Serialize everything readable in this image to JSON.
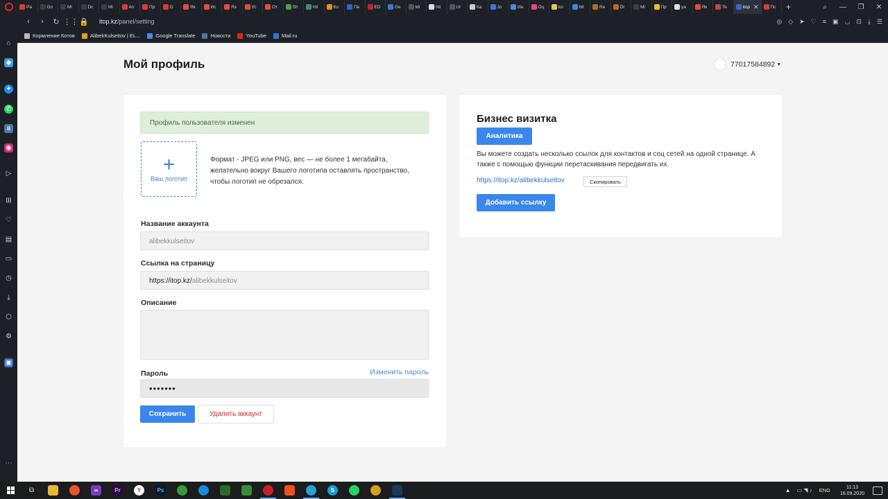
{
  "browser": {
    "tabs": [
      {
        "label": "Pa",
        "color": "#d83a3a"
      },
      {
        "label": "Go",
        "color": "#3a3f46"
      },
      {
        "label": "Mi",
        "color": "#3a3f46"
      },
      {
        "label": "Dc",
        "color": "#3a3f46"
      },
      {
        "label": "Mi",
        "color": "#3a3f46"
      },
      {
        "label": "An",
        "color": "#d83a3a"
      },
      {
        "label": "Пр",
        "color": "#d83a3a"
      },
      {
        "label": "О",
        "color": "#d83a3a"
      },
      {
        "label": "Як",
        "color": "#e84b3c"
      },
      {
        "label": "Ис",
        "color": "#e84b3c"
      },
      {
        "label": "Яз",
        "color": "#e84b3c"
      },
      {
        "label": "Ус",
        "color": "#e84b3c"
      },
      {
        "label": "От",
        "color": "#e84b3c"
      },
      {
        "label": "Sh",
        "color": "#4aa04a"
      },
      {
        "label": "htt",
        "color": "#3d8f6a"
      },
      {
        "label": "Ко",
        "color": "#e28b2a"
      },
      {
        "label": "Пе",
        "color": "#2a6ac8"
      },
      {
        "label": "ED",
        "color": "#c8202a"
      },
      {
        "label": "Ge",
        "color": "#3a7ad0"
      },
      {
        "label": "Mi",
        "color": "#555"
      },
      {
        "label": "htt",
        "color": "#ddd"
      },
      {
        "label": "Ur",
        "color": "#555"
      },
      {
        "label": "Ка",
        "color": "#ccc"
      },
      {
        "label": "Jo",
        "color": "#3a7ad0"
      },
      {
        "label": "Ин",
        "color": "#4a8ad8"
      },
      {
        "label": "Оц",
        "color": "#e84b7c"
      },
      {
        "label": "ko",
        "color": "#e8c84b"
      },
      {
        "label": "htt",
        "color": "#3a8ae8"
      },
      {
        "label": "Re",
        "color": "#b86a2a"
      },
      {
        "label": "Dr",
        "color": "#b86a2a"
      },
      {
        "label": "Mi",
        "color": "#3a3f46"
      },
      {
        "label": "Пр",
        "color": "#f0c020"
      },
      {
        "label": "ya",
        "color": "#e0e0e0"
      },
      {
        "label": "Як",
        "color": "#e84b3c"
      },
      {
        "label": "Te",
        "color": "#b84a4a"
      }
    ],
    "active_tab": {
      "label": "itop",
      "close": "✕"
    },
    "after_tab": {
      "label": "Пс"
    },
    "new_tab": "+",
    "url_host": "itop.kz",
    "url_path": "/panel/setting",
    "bookmarks": [
      {
        "label": "Кормление Котов",
        "color": "#bbb"
      },
      {
        "label": "AlibekKulseitov | EL...",
        "color": "#e0a020"
      },
      {
        "label": "Google Translate",
        "color": "#4a8ae8"
      },
      {
        "label": "Новости",
        "color": "#4a76a8"
      },
      {
        "label": "YouTube",
        "color": "#e62117"
      },
      {
        "label": "Mail.ru",
        "color": "#2a78d8"
      }
    ]
  },
  "page": {
    "title": "Мой профиль",
    "user_phone": "77017584892"
  },
  "profile": {
    "alert": "Профиль пользователя изменен",
    "logo_label": "Ваш логотип",
    "logo_hint": "Формат - JPEG или PNG, вес — не более 1 мегабайта, желательно вокруг Вашего логотипа оставлять пространство, чтобы логотип не обрезался.",
    "account_name_label": "Название аккаунта",
    "account_name_value": "alibekkulseitov",
    "page_link_label": "Ссылка на страницу",
    "page_link_prefix": "https://itop.kz/",
    "page_link_value": "alibekkulseitov",
    "description_label": "Описание",
    "description_value": "",
    "password_label": "Пароль",
    "change_password": "Изменить пароль",
    "password_value": "•••••••",
    "save_button": "Сохранить",
    "delete_button": "Удалить аккаунт"
  },
  "business": {
    "title": "Бизнес визитка",
    "analytics_button": "Аналитика",
    "hint": "Вы можете создать несколько ссылок для контактов и соц сетей на одной странице. А также с помощью функции перетаскивания передвигать их.",
    "link": "https://itop.kz/alibekkulseitov",
    "copy_button": "Скопировать",
    "add_link_button": "Добавить ссылку"
  },
  "taskbar": {
    "lang": "ENG",
    "time": "11:13",
    "date": "16.09.2020"
  }
}
